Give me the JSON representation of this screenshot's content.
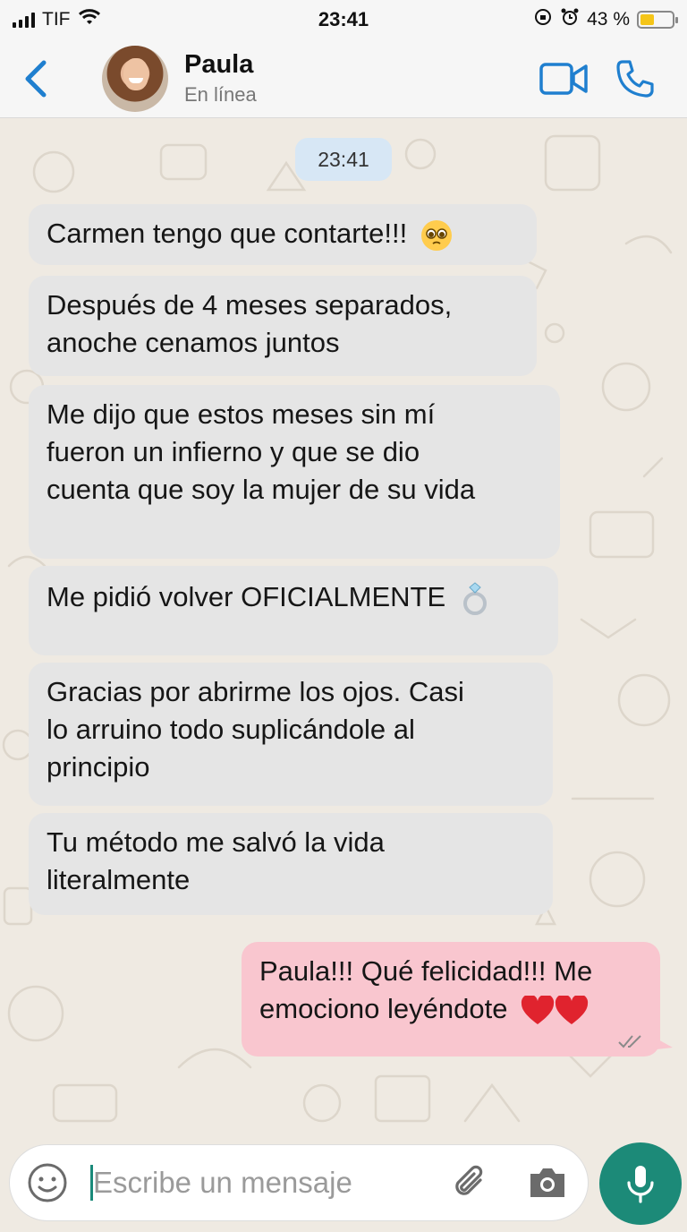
{
  "status_bar": {
    "carrier": "TIF",
    "time": "23:41",
    "battery_percent": "43 %",
    "battery_level": 0.43,
    "battery_color": "#f5c518"
  },
  "header": {
    "back_icon": "chevron-left-icon",
    "contact_name": "Paula",
    "contact_status": "En línea",
    "video_icon": "video-camera-icon",
    "call_icon": "phone-icon",
    "accent_color": "#1f7fcf"
  },
  "chat": {
    "date_chip": "23:41",
    "messages": [
      {
        "direction": "in",
        "text": "Carmen tengo que contarte!!!",
        "emoji": "pleading-face"
      },
      {
        "direction": "in",
        "lines": [
          "Después de 4 meses separados,",
          "anoche cenamos juntos"
        ]
      },
      {
        "direction": "in",
        "lines": [
          "Me dijo que estos meses sin mí",
          "fueron un infierno y que se dio",
          "cuenta que soy la mujer de su vida"
        ]
      },
      {
        "direction": "in",
        "text": "Me pidió volver OFICIALMENTE",
        "emoji": "ring"
      },
      {
        "direction": "in",
        "lines": [
          "Gracias por abrirme los ojos. Casi",
          "lo arruino todo suplicándole al",
          "principio"
        ]
      },
      {
        "direction": "in",
        "lines": [
          "Tu método me salvó la vida",
          "literalmente"
        ]
      },
      {
        "direction": "out",
        "lines": [
          "Paula!!! Qué felicidad!!! Me",
          "emociono leyéndote"
        ],
        "emoji": "red-heart x2",
        "status": "delivered-double-check"
      }
    ],
    "incoming_bubble_color": "#e5e5e5",
    "outgoing_bubble_color": "#f9c6cf"
  },
  "composer": {
    "placeholder": "Escribe un mensaje",
    "mic_color": "#1c8a78"
  }
}
